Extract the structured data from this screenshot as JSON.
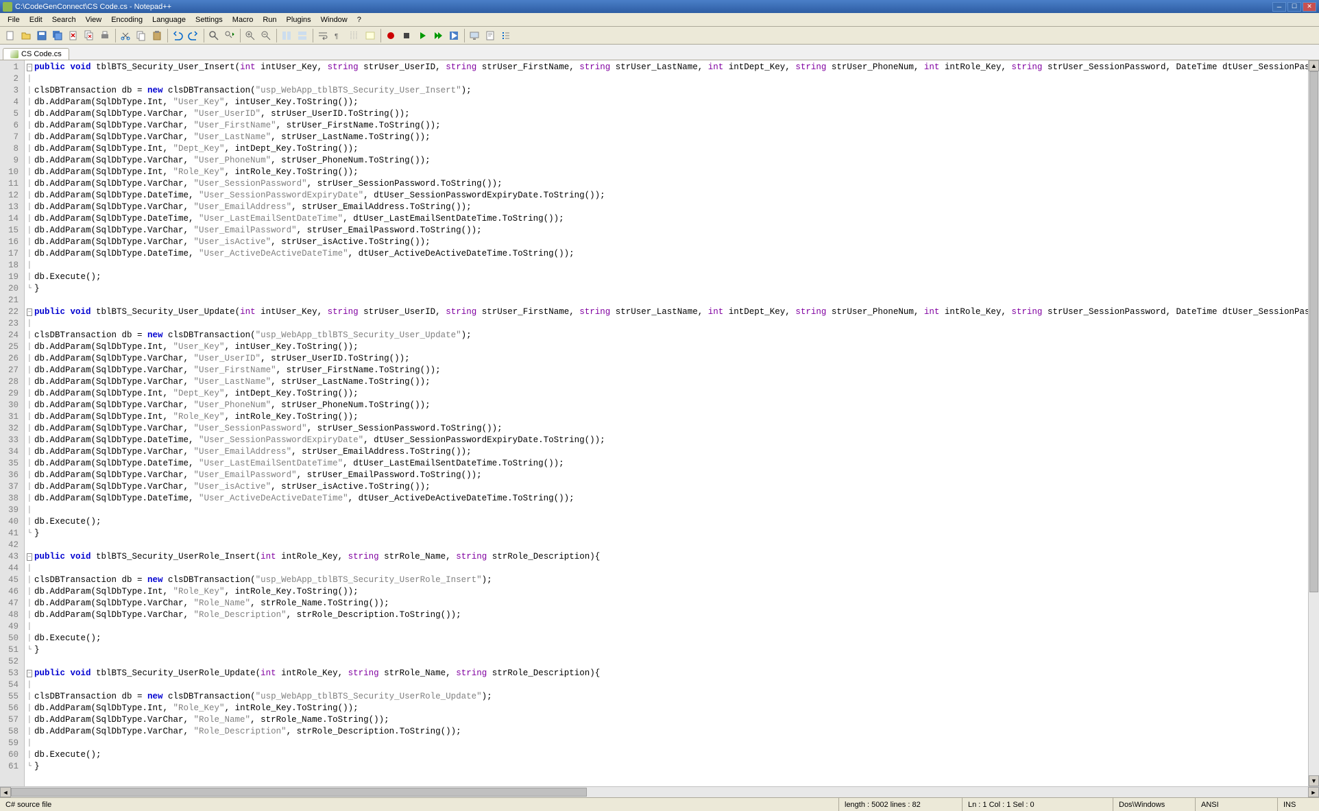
{
  "title": "C:\\CodeGenConnect\\CS Code.cs - Notepad++",
  "menu": [
    "File",
    "Edit",
    "Search",
    "View",
    "Encoding",
    "Language",
    "Settings",
    "Macro",
    "Run",
    "Plugins",
    "Window",
    "?"
  ],
  "tab": {
    "label": "CS Code.cs"
  },
  "status": {
    "filetype": "C# source file",
    "length": "length : 5002     lines : 82",
    "pos": "Ln : 1    Col : 1    Sel : 0",
    "eol": "Dos\\Windows",
    "encoding": "ANSI",
    "insert": "INS"
  },
  "toolbar_icons": [
    "new-icon",
    "open-icon",
    "save-icon",
    "save-all-icon",
    "close-icon",
    "close-all-icon",
    "print-icon",
    "sep",
    "cut-icon",
    "copy-icon",
    "paste-icon",
    "sep",
    "undo-icon",
    "redo-icon",
    "sep",
    "find-icon",
    "replace-icon",
    "sep",
    "zoom-in-icon",
    "zoom-out-icon",
    "sep",
    "sync-v-icon",
    "sync-h-icon",
    "sep",
    "wrap-icon",
    "show-all-icon",
    "indent-guide-icon",
    "lang-icon",
    "sep",
    "record-icon",
    "stop-icon",
    "play-icon",
    "play-multi-icon",
    "save-macro-icon",
    "sep",
    "monitor-icon",
    "doc-map-icon",
    "func-list-icon"
  ],
  "lines": [
    {
      "n": 1,
      "fold": "⊟",
      "tokens": [
        [
          "kw",
          "public"
        ],
        [
          "p",
          " "
        ],
        [
          "kw",
          "void"
        ],
        [
          "p",
          " tblBTS_Security_User_Insert("
        ],
        [
          "kw2",
          "int"
        ],
        [
          "p",
          " intUser_Key, "
        ],
        [
          "kw2",
          "string"
        ],
        [
          "p",
          " strUser_UserID, "
        ],
        [
          "kw2",
          "string"
        ],
        [
          "p",
          " strUser_FirstName, "
        ],
        [
          "kw2",
          "string"
        ],
        [
          "p",
          " strUser_LastName, "
        ],
        [
          "kw2",
          "int"
        ],
        [
          "p",
          " intDept_Key, "
        ],
        [
          "kw2",
          "string"
        ],
        [
          "p",
          " strUser_PhoneNum, "
        ],
        [
          "kw2",
          "int"
        ],
        [
          "p",
          " intRole_Key, "
        ],
        [
          "kw2",
          "string"
        ],
        [
          "p",
          " strUser_SessionPassword, DateTime dtUser_SessionPasswordExpiryDate"
        ]
      ]
    },
    {
      "n": 2,
      "fold": "|",
      "tokens": [
        [
          "p",
          ""
        ]
      ]
    },
    {
      "n": 3,
      "fold": "|",
      "tokens": [
        [
          "p",
          "clsDBTransaction db = "
        ],
        [
          "kw",
          "new"
        ],
        [
          "p",
          " clsDBTransaction("
        ],
        [
          "str",
          "\"usp_WebApp_tblBTS_Security_User_Insert\""
        ],
        [
          "p",
          ");"
        ]
      ]
    },
    {
      "n": 4,
      "fold": "|",
      "tokens": [
        [
          "p",
          "db.AddParam(SqlDbType.Int, "
        ],
        [
          "str",
          "\"User_Key\""
        ],
        [
          "p",
          ", intUser_Key.ToString());"
        ]
      ]
    },
    {
      "n": 5,
      "fold": "|",
      "tokens": [
        [
          "p",
          "db.AddParam(SqlDbType.VarChar, "
        ],
        [
          "str",
          "\"User_UserID\""
        ],
        [
          "p",
          ", strUser_UserID.ToString());"
        ]
      ]
    },
    {
      "n": 6,
      "fold": "|",
      "tokens": [
        [
          "p",
          "db.AddParam(SqlDbType.VarChar, "
        ],
        [
          "str",
          "\"User_FirstName\""
        ],
        [
          "p",
          ", strUser_FirstName.ToString());"
        ]
      ]
    },
    {
      "n": 7,
      "fold": "|",
      "tokens": [
        [
          "p",
          "db.AddParam(SqlDbType.VarChar, "
        ],
        [
          "str",
          "\"User_LastName\""
        ],
        [
          "p",
          ", strUser_LastName.ToString());"
        ]
      ]
    },
    {
      "n": 8,
      "fold": "|",
      "tokens": [
        [
          "p",
          "db.AddParam(SqlDbType.Int, "
        ],
        [
          "str",
          "\"Dept_Key\""
        ],
        [
          "p",
          ", intDept_Key.ToString());"
        ]
      ]
    },
    {
      "n": 9,
      "fold": "|",
      "tokens": [
        [
          "p",
          "db.AddParam(SqlDbType.VarChar, "
        ],
        [
          "str",
          "\"User_PhoneNum\""
        ],
        [
          "p",
          ", strUser_PhoneNum.ToString());"
        ]
      ]
    },
    {
      "n": 10,
      "fold": "|",
      "tokens": [
        [
          "p",
          "db.AddParam(SqlDbType.Int, "
        ],
        [
          "str",
          "\"Role_Key\""
        ],
        [
          "p",
          ", intRole_Key.ToString());"
        ]
      ]
    },
    {
      "n": 11,
      "fold": "|",
      "tokens": [
        [
          "p",
          "db.AddParam(SqlDbType.VarChar, "
        ],
        [
          "str",
          "\"User_SessionPassword\""
        ],
        [
          "p",
          ", strUser_SessionPassword.ToString());"
        ]
      ]
    },
    {
      "n": 12,
      "fold": "|",
      "tokens": [
        [
          "p",
          "db.AddParam(SqlDbType.DateTime, "
        ],
        [
          "str",
          "\"User_SessionPasswordExpiryDate\""
        ],
        [
          "p",
          ", dtUser_SessionPasswordExpiryDate.ToString());"
        ]
      ]
    },
    {
      "n": 13,
      "fold": "|",
      "tokens": [
        [
          "p",
          "db.AddParam(SqlDbType.VarChar, "
        ],
        [
          "str",
          "\"User_EmailAddress\""
        ],
        [
          "p",
          ", strUser_EmailAddress.ToString());"
        ]
      ]
    },
    {
      "n": 14,
      "fold": "|",
      "tokens": [
        [
          "p",
          "db.AddParam(SqlDbType.DateTime, "
        ],
        [
          "str",
          "\"User_LastEmailSentDateTime\""
        ],
        [
          "p",
          ", dtUser_LastEmailSentDateTime.ToString());"
        ]
      ]
    },
    {
      "n": 15,
      "fold": "|",
      "tokens": [
        [
          "p",
          "db.AddParam(SqlDbType.VarChar, "
        ],
        [
          "str",
          "\"User_EmailPassword\""
        ],
        [
          "p",
          ", strUser_EmailPassword.ToString());"
        ]
      ]
    },
    {
      "n": 16,
      "fold": "|",
      "tokens": [
        [
          "p",
          "db.AddParam(SqlDbType.VarChar, "
        ],
        [
          "str",
          "\"User_isActive\""
        ],
        [
          "p",
          ", strUser_isActive.ToString());"
        ]
      ]
    },
    {
      "n": 17,
      "fold": "|",
      "tokens": [
        [
          "p",
          "db.AddParam(SqlDbType.DateTime, "
        ],
        [
          "str",
          "\"User_ActiveDeActiveDateTime\""
        ],
        [
          "p",
          ", dtUser_ActiveDeActiveDateTime.ToString());"
        ]
      ]
    },
    {
      "n": 18,
      "fold": "|",
      "tokens": [
        [
          "p",
          ""
        ]
      ]
    },
    {
      "n": 19,
      "fold": "|",
      "tokens": [
        [
          "p",
          "db.Execute();"
        ]
      ]
    },
    {
      "n": 20,
      "fold": "└",
      "tokens": [
        [
          "p",
          "}"
        ]
      ]
    },
    {
      "n": 21,
      "fold": "",
      "tokens": [
        [
          "p",
          ""
        ]
      ]
    },
    {
      "n": 22,
      "fold": "⊟",
      "tokens": [
        [
          "kw",
          "public"
        ],
        [
          "p",
          " "
        ],
        [
          "kw",
          "void"
        ],
        [
          "p",
          " tblBTS_Security_User_Update("
        ],
        [
          "kw2",
          "int"
        ],
        [
          "p",
          " intUser_Key, "
        ],
        [
          "kw2",
          "string"
        ],
        [
          "p",
          " strUser_UserID, "
        ],
        [
          "kw2",
          "string"
        ],
        [
          "p",
          " strUser_FirstName, "
        ],
        [
          "kw2",
          "string"
        ],
        [
          "p",
          " strUser_LastName, "
        ],
        [
          "kw2",
          "int"
        ],
        [
          "p",
          " intDept_Key, "
        ],
        [
          "kw2",
          "string"
        ],
        [
          "p",
          " strUser_PhoneNum, "
        ],
        [
          "kw2",
          "int"
        ],
        [
          "p",
          " intRole_Key, "
        ],
        [
          "kw2",
          "string"
        ],
        [
          "p",
          " strUser_SessionPassword, DateTime dtUser_SessionPasswordExpiryDate"
        ]
      ]
    },
    {
      "n": 23,
      "fold": "|",
      "tokens": [
        [
          "p",
          ""
        ]
      ]
    },
    {
      "n": 24,
      "fold": "|",
      "tokens": [
        [
          "p",
          "clsDBTransaction db = "
        ],
        [
          "kw",
          "new"
        ],
        [
          "p",
          " clsDBTransaction("
        ],
        [
          "str",
          "\"usp_WebApp_tblBTS_Security_User_Update\""
        ],
        [
          "p",
          ");"
        ]
      ]
    },
    {
      "n": 25,
      "fold": "|",
      "tokens": [
        [
          "p",
          "db.AddParam(SqlDbType.Int, "
        ],
        [
          "str",
          "\"User_Key\""
        ],
        [
          "p",
          ", intUser_Key.ToString());"
        ]
      ]
    },
    {
      "n": 26,
      "fold": "|",
      "tokens": [
        [
          "p",
          "db.AddParam(SqlDbType.VarChar, "
        ],
        [
          "str",
          "\"User_UserID\""
        ],
        [
          "p",
          ", strUser_UserID.ToString());"
        ]
      ]
    },
    {
      "n": 27,
      "fold": "|",
      "tokens": [
        [
          "p",
          "db.AddParam(SqlDbType.VarChar, "
        ],
        [
          "str",
          "\"User_FirstName\""
        ],
        [
          "p",
          ", strUser_FirstName.ToString());"
        ]
      ]
    },
    {
      "n": 28,
      "fold": "|",
      "tokens": [
        [
          "p",
          "db.AddParam(SqlDbType.VarChar, "
        ],
        [
          "str",
          "\"User_LastName\""
        ],
        [
          "p",
          ", strUser_LastName.ToString());"
        ]
      ]
    },
    {
      "n": 29,
      "fold": "|",
      "tokens": [
        [
          "p",
          "db.AddParam(SqlDbType.Int, "
        ],
        [
          "str",
          "\"Dept_Key\""
        ],
        [
          "p",
          ", intDept_Key.ToString());"
        ]
      ]
    },
    {
      "n": 30,
      "fold": "|",
      "tokens": [
        [
          "p",
          "db.AddParam(SqlDbType.VarChar, "
        ],
        [
          "str",
          "\"User_PhoneNum\""
        ],
        [
          "p",
          ", strUser_PhoneNum.ToString());"
        ]
      ]
    },
    {
      "n": 31,
      "fold": "|",
      "tokens": [
        [
          "p",
          "db.AddParam(SqlDbType.Int, "
        ],
        [
          "str",
          "\"Role_Key\""
        ],
        [
          "p",
          ", intRole_Key.ToString());"
        ]
      ]
    },
    {
      "n": 32,
      "fold": "|",
      "tokens": [
        [
          "p",
          "db.AddParam(SqlDbType.VarChar, "
        ],
        [
          "str",
          "\"User_SessionPassword\""
        ],
        [
          "p",
          ", strUser_SessionPassword.ToString());"
        ]
      ]
    },
    {
      "n": 33,
      "fold": "|",
      "tokens": [
        [
          "p",
          "db.AddParam(SqlDbType.DateTime, "
        ],
        [
          "str",
          "\"User_SessionPasswordExpiryDate\""
        ],
        [
          "p",
          ", dtUser_SessionPasswordExpiryDate.ToString());"
        ]
      ]
    },
    {
      "n": 34,
      "fold": "|",
      "tokens": [
        [
          "p",
          "db.AddParam(SqlDbType.VarChar, "
        ],
        [
          "str",
          "\"User_EmailAddress\""
        ],
        [
          "p",
          ", strUser_EmailAddress.ToString());"
        ]
      ]
    },
    {
      "n": 35,
      "fold": "|",
      "tokens": [
        [
          "p",
          "db.AddParam(SqlDbType.DateTime, "
        ],
        [
          "str",
          "\"User_LastEmailSentDateTime\""
        ],
        [
          "p",
          ", dtUser_LastEmailSentDateTime.ToString());"
        ]
      ]
    },
    {
      "n": 36,
      "fold": "|",
      "tokens": [
        [
          "p",
          "db.AddParam(SqlDbType.VarChar, "
        ],
        [
          "str",
          "\"User_EmailPassword\""
        ],
        [
          "p",
          ", strUser_EmailPassword.ToString());"
        ]
      ]
    },
    {
      "n": 37,
      "fold": "|",
      "tokens": [
        [
          "p",
          "db.AddParam(SqlDbType.VarChar, "
        ],
        [
          "str",
          "\"User_isActive\""
        ],
        [
          "p",
          ", strUser_isActive.ToString());"
        ]
      ]
    },
    {
      "n": 38,
      "fold": "|",
      "tokens": [
        [
          "p",
          "db.AddParam(SqlDbType.DateTime, "
        ],
        [
          "str",
          "\"User_ActiveDeActiveDateTime\""
        ],
        [
          "p",
          ", dtUser_ActiveDeActiveDateTime.ToString());"
        ]
      ]
    },
    {
      "n": 39,
      "fold": "|",
      "tokens": [
        [
          "p",
          ""
        ]
      ]
    },
    {
      "n": 40,
      "fold": "|",
      "tokens": [
        [
          "p",
          "db.Execute();"
        ]
      ]
    },
    {
      "n": 41,
      "fold": "└",
      "tokens": [
        [
          "p",
          "}"
        ]
      ]
    },
    {
      "n": 42,
      "fold": "",
      "tokens": [
        [
          "p",
          ""
        ]
      ]
    },
    {
      "n": 43,
      "fold": "⊟",
      "tokens": [
        [
          "kw",
          "public"
        ],
        [
          "p",
          " "
        ],
        [
          "kw",
          "void"
        ],
        [
          "p",
          " tblBTS_Security_UserRole_Insert("
        ],
        [
          "kw2",
          "int"
        ],
        [
          "p",
          " intRole_Key, "
        ],
        [
          "kw2",
          "string"
        ],
        [
          "p",
          " strRole_Name, "
        ],
        [
          "kw2",
          "string"
        ],
        [
          "p",
          " strRole_Description){"
        ]
      ]
    },
    {
      "n": 44,
      "fold": "|",
      "tokens": [
        [
          "p",
          ""
        ]
      ]
    },
    {
      "n": 45,
      "fold": "|",
      "tokens": [
        [
          "p",
          "clsDBTransaction db = "
        ],
        [
          "kw",
          "new"
        ],
        [
          "p",
          " clsDBTransaction("
        ],
        [
          "str",
          "\"usp_WebApp_tblBTS_Security_UserRole_Insert\""
        ],
        [
          "p",
          ");"
        ]
      ]
    },
    {
      "n": 46,
      "fold": "|",
      "tokens": [
        [
          "p",
          "db.AddParam(SqlDbType.Int, "
        ],
        [
          "str",
          "\"Role_Key\""
        ],
        [
          "p",
          ", intRole_Key.ToString());"
        ]
      ]
    },
    {
      "n": 47,
      "fold": "|",
      "tokens": [
        [
          "p",
          "db.AddParam(SqlDbType.VarChar, "
        ],
        [
          "str",
          "\"Role_Name\""
        ],
        [
          "p",
          ", strRole_Name.ToString());"
        ]
      ]
    },
    {
      "n": 48,
      "fold": "|",
      "tokens": [
        [
          "p",
          "db.AddParam(SqlDbType.VarChar, "
        ],
        [
          "str",
          "\"Role_Description\""
        ],
        [
          "p",
          ", strRole_Description.ToString());"
        ]
      ]
    },
    {
      "n": 49,
      "fold": "|",
      "tokens": [
        [
          "p",
          ""
        ]
      ]
    },
    {
      "n": 50,
      "fold": "|",
      "tokens": [
        [
          "p",
          "db.Execute();"
        ]
      ]
    },
    {
      "n": 51,
      "fold": "└",
      "tokens": [
        [
          "p",
          "}"
        ]
      ]
    },
    {
      "n": 52,
      "fold": "",
      "tokens": [
        [
          "p",
          ""
        ]
      ]
    },
    {
      "n": 53,
      "fold": "⊟",
      "tokens": [
        [
          "kw",
          "public"
        ],
        [
          "p",
          " "
        ],
        [
          "kw",
          "void"
        ],
        [
          "p",
          " tblBTS_Security_UserRole_Update("
        ],
        [
          "kw2",
          "int"
        ],
        [
          "p",
          " intRole_Key, "
        ],
        [
          "kw2",
          "string"
        ],
        [
          "p",
          " strRole_Name, "
        ],
        [
          "kw2",
          "string"
        ],
        [
          "p",
          " strRole_Description){"
        ]
      ]
    },
    {
      "n": 54,
      "fold": "|",
      "tokens": [
        [
          "p",
          ""
        ]
      ]
    },
    {
      "n": 55,
      "fold": "|",
      "tokens": [
        [
          "p",
          "clsDBTransaction db = "
        ],
        [
          "kw",
          "new"
        ],
        [
          "p",
          " clsDBTransaction("
        ],
        [
          "str",
          "\"usp_WebApp_tblBTS_Security_UserRole_Update\""
        ],
        [
          "p",
          ");"
        ]
      ]
    },
    {
      "n": 56,
      "fold": "|",
      "tokens": [
        [
          "p",
          "db.AddParam(SqlDbType.Int, "
        ],
        [
          "str",
          "\"Role_Key\""
        ],
        [
          "p",
          ", intRole_Key.ToString());"
        ]
      ]
    },
    {
      "n": 57,
      "fold": "|",
      "tokens": [
        [
          "p",
          "db.AddParam(SqlDbType.VarChar, "
        ],
        [
          "str",
          "\"Role_Name\""
        ],
        [
          "p",
          ", strRole_Name.ToString());"
        ]
      ]
    },
    {
      "n": 58,
      "fold": "|",
      "tokens": [
        [
          "p",
          "db.AddParam(SqlDbType.VarChar, "
        ],
        [
          "str",
          "\"Role_Description\""
        ],
        [
          "p",
          ", strRole_Description.ToString());"
        ]
      ]
    },
    {
      "n": 59,
      "fold": "|",
      "tokens": [
        [
          "p",
          ""
        ]
      ]
    },
    {
      "n": 60,
      "fold": "|",
      "tokens": [
        [
          "p",
          "db.Execute();"
        ]
      ]
    },
    {
      "n": 61,
      "fold": "└",
      "tokens": [
        [
          "p",
          "}"
        ]
      ]
    }
  ]
}
